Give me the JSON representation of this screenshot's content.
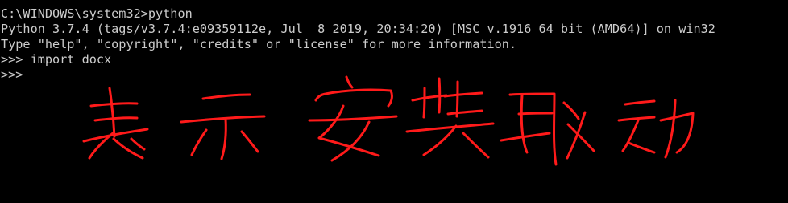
{
  "console": {
    "lines": [
      "C:\\WINDOWS\\system32>python",
      "Python 3.7.4 (tags/v3.7.4:e09359112e, Jul  8 2019, 20:34:20) [MSC v.1916 64 bit (AMD64)] on win32",
      "Type \"help\", \"copyright\", \"credits\" or \"license\" for more information.",
      ">>> import docx",
      ">>>"
    ]
  },
  "annotation": {
    "color": "#ff1a1a"
  }
}
